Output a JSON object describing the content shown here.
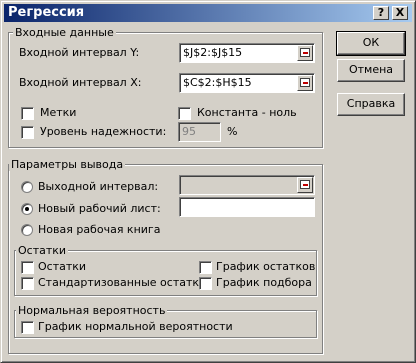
{
  "window": {
    "title": "Регрессия",
    "help_btn": "?",
    "close_btn": "X"
  },
  "input_group": {
    "label": "Входные данные",
    "y_range_label": "Входной интервал Y:",
    "y_range_value": "$J$2:$J$15",
    "x_range_label": "Входной интервал X:",
    "x_range_value": "$C$2:$H$15",
    "labels_checkbox": "Метки",
    "constant_zero_checkbox": "Константа - ноль",
    "confidence_checkbox": "Уровень надежности:",
    "confidence_value": "95",
    "confidence_unit": "%"
  },
  "output_group": {
    "label": "Параметры вывода",
    "output_range_radio": "Выходной интервал:",
    "new_sheet_radio": "Новый рабочий лист:",
    "new_workbook_radio": "Новая рабочая книга",
    "selected": "new_sheet"
  },
  "residuals_group": {
    "label": "Остатки",
    "residuals": "Остатки",
    "standardized": "Стандартизованные остатки",
    "residual_plots": "График остатков",
    "line_fit_plots": "График подбора"
  },
  "normal_group": {
    "label": "Нормальная вероятность",
    "normal_plot": "График нормальной вероятности"
  },
  "buttons": {
    "ok": "ОК",
    "cancel": "Отмена",
    "help": "Справка"
  }
}
